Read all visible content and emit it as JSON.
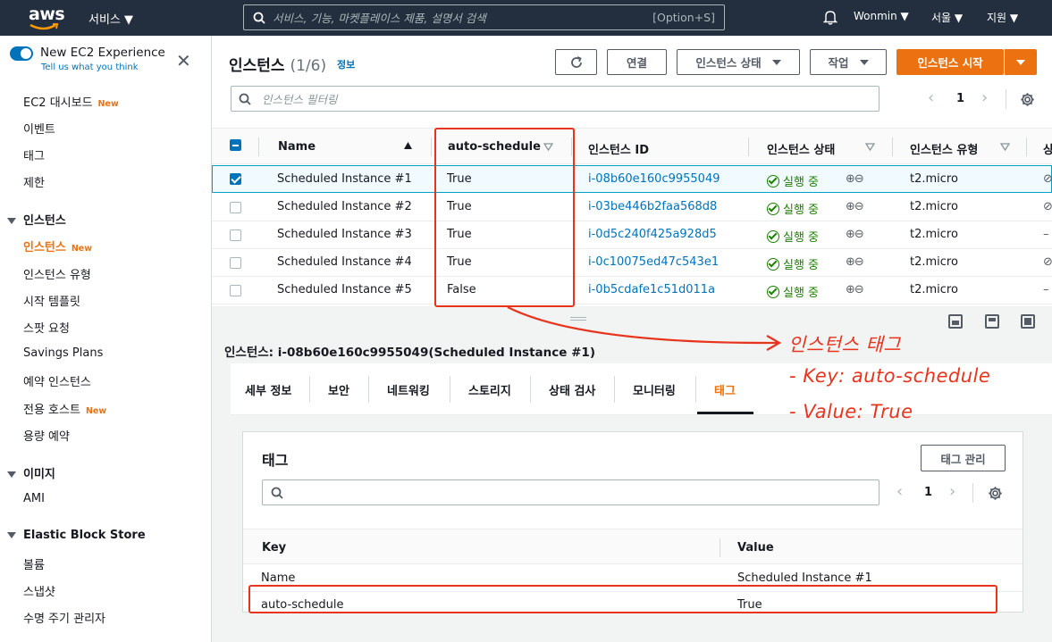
{
  "topbar": {
    "logo": "aws",
    "services": "서비스 ▼",
    "search_placeholder": "서비스, 기능, 마켓플레이스 제품, 설명서 검색",
    "search_shortcut": "[Option+S]",
    "user": "Wonmin ▼",
    "region": "서울 ▼",
    "support": "지원 ▼"
  },
  "sidebar": {
    "new_experience": "New EC2 Experience",
    "tell_us": "Tell us what you think",
    "new_badge": "New",
    "items_top": [
      {
        "label": "EC2 대시보드",
        "new": true
      },
      {
        "label": "이벤트"
      },
      {
        "label": "태그"
      },
      {
        "label": "제한"
      }
    ],
    "section_instances": "인스턴스",
    "items_instances": [
      {
        "label": "인스턴스",
        "new": true
      },
      {
        "label": "인스턴스 유형"
      },
      {
        "label": "시작 템플릿"
      },
      {
        "label": "스팟 요청"
      },
      {
        "label": "Savings Plans"
      },
      {
        "label": "예약 인스턴스"
      },
      {
        "label": "전용 호스트",
        "new": true
      },
      {
        "label": "용량 예약"
      }
    ],
    "section_images": "이미지",
    "items_images": [
      {
        "label": "AMI"
      }
    ],
    "section_ebs": "Elastic Block Store",
    "items_ebs": [
      {
        "label": "볼륨"
      },
      {
        "label": "스냅샷"
      },
      {
        "label": "수명 주기 관리자"
      }
    ]
  },
  "instances": {
    "title": "인스턴스",
    "count": "(1/6)",
    "info": "정보",
    "connect": "연결",
    "state_menu": "인스턴스 상태",
    "actions": "작업",
    "launch": "인스턴스 시작",
    "filter_placeholder": "인스턴스 필터링",
    "page": "1",
    "columns": [
      "Name",
      "auto-schedule",
      "인스턴스 ID",
      "인스턴스 상태",
      "인스턴스 유형",
      "상"
    ],
    "rows": [
      {
        "name": "Scheduled Instance #1",
        "auto": "True",
        "id": "i-08b60e160c9955049",
        "state": "실행 중",
        "type": "t2.micro",
        "selected": true
      },
      {
        "name": "Scheduled Instance #2",
        "auto": "True",
        "id": "i-03be446b2faa568d8",
        "state": "실행 중",
        "type": "t2.micro"
      },
      {
        "name": "Scheduled Instance #3",
        "auto": "True",
        "id": "i-0d5c240f425a928d5",
        "state": "실행 중",
        "type": "t2.micro"
      },
      {
        "name": "Scheduled Instance #4",
        "auto": "True",
        "id": "i-0c10075ed47c543e1",
        "state": "실행 중",
        "type": "t2.micro"
      },
      {
        "name": "Scheduled Instance #5",
        "auto": "False",
        "id": "i-0b5cdafe1c51d011a",
        "state": "실행 중",
        "type": "t2.micro"
      }
    ]
  },
  "detail": {
    "title": "인스턴스: i-08b60e160c9955049(Scheduled Instance #1)",
    "tabs": [
      "세부 정보",
      "보안",
      "네트워킹",
      "스토리지",
      "상태 검사",
      "모니터링",
      "태그"
    ],
    "tags_heading": "태그",
    "manage_tags": "태그 관리",
    "page": "1",
    "kv_headers": [
      "Key",
      "Value"
    ],
    "kv_rows": [
      {
        "key": "Name",
        "value": "Scheduled Instance #1"
      },
      {
        "key": "auto-schedule",
        "value": "True"
      }
    ]
  },
  "annotation": {
    "title": "인스턴스 태그",
    "line1": "- Key: auto-schedule",
    "line2": "- Value: True",
    "color": "#e8341c"
  }
}
